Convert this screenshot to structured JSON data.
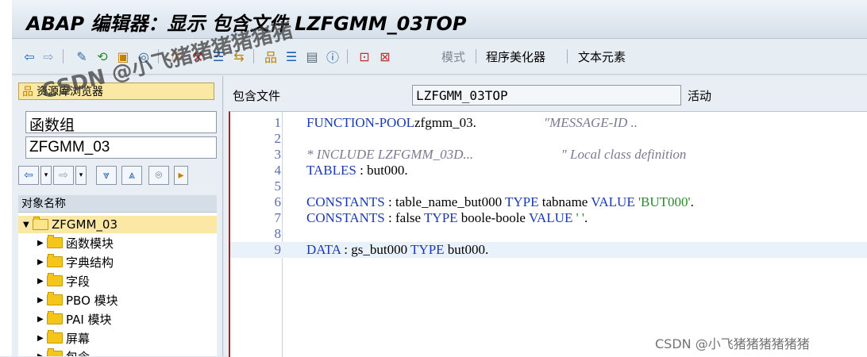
{
  "title": "ABAP 编辑器：显示 包含文件 LZFGMM_03TOP",
  "toolbar": {
    "items_text": {
      "mode": "模式",
      "pretty_printer": "程序美化器",
      "text_elements": "文本元素"
    },
    "icons": [
      "back-arrow-icon",
      "forward-arrow-icon",
      "other-object-icon",
      "display-change-icon",
      "active-inactive-icon",
      "where-used-icon",
      "check-icon",
      "activate-icon",
      "test-icon",
      "object-list-icon",
      "navigation-window-icon",
      "split-screen-icon",
      "info-icon",
      "breakpoint-icon",
      "session-breakpoint-icon"
    ]
  },
  "left": {
    "repo_browser": "资源库浏览器",
    "object_type": "函数组",
    "object_name": "ZFGMM_03",
    "tree_header": "对象名称",
    "tree": [
      {
        "label": "ZFGMM_03",
        "level": 0,
        "open": true,
        "selected": true
      },
      {
        "label": "函数模块",
        "level": 1
      },
      {
        "label": "字典结构",
        "level": 1
      },
      {
        "label": "字段",
        "level": 1
      },
      {
        "label": "PBO 模块",
        "level": 1
      },
      {
        "label": "PAI 模块",
        "level": 1
      },
      {
        "label": "屏幕",
        "level": 1
      },
      {
        "label": "包含",
        "level": 1
      }
    ]
  },
  "right": {
    "include_label": "包含文件",
    "include_value": "LZFGMM_03TOP",
    "status": "活动"
  },
  "code": {
    "lines": [
      {
        "n": "1",
        "parts": [
          [
            "kw",
            "FUNCTION-POOL"
          ],
          [
            "",
            "zfgmm_03."
          ],
          [
            "cmt",
            "                    \"MESSAGE-ID .."
          ]
        ]
      },
      {
        "n": "2",
        "parts": []
      },
      {
        "n": "3",
        "parts": [
          [
            "cmt",
            "* INCLUDE LZFGMM_03D...                          \" Local class definition"
          ]
        ]
      },
      {
        "n": "4",
        "parts": [
          [
            "kw",
            "TABLES"
          ],
          [
            "",
            " : but000."
          ]
        ]
      },
      {
        "n": "5",
        "parts": []
      },
      {
        "n": "6",
        "parts": [
          [
            "kw",
            "CONSTANTS"
          ],
          [
            "",
            " : table_name_but000 "
          ],
          [
            "kw",
            "TYPE"
          ],
          [
            "",
            " tabname "
          ],
          [
            "kw",
            "VALUE"
          ],
          [
            "str",
            " 'BUT000'"
          ],
          [
            "",
            "."
          ]
        ]
      },
      {
        "n": "7",
        "parts": [
          [
            "kw",
            "CONSTANTS"
          ],
          [
            "",
            " : false "
          ],
          [
            "kw",
            "TYPE"
          ],
          [
            "",
            " boole-boole "
          ],
          [
            "kw",
            "VALUE"
          ],
          [
            "str",
            " ' '"
          ],
          [
            "",
            "."
          ]
        ]
      },
      {
        "n": "8",
        "parts": []
      },
      {
        "n": "9",
        "parts": [
          [
            "kw",
            "DATA"
          ],
          [
            "",
            " : gs_but000 "
          ],
          [
            "kw",
            "TYPE"
          ],
          [
            "",
            " but000."
          ]
        ]
      }
    ],
    "current_line": "9"
  },
  "watermark": "CSDN @小飞猪猪猪猪猪猪",
  "watermark_overlay": "CSDN @小飞猪猪猪猪猪猪"
}
